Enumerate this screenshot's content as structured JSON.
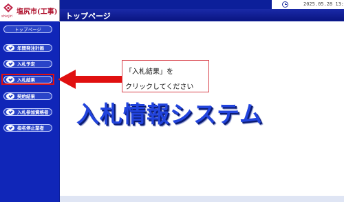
{
  "logo": {
    "name": "塩尻市(工事)",
    "subtext": "shiojiri"
  },
  "header": {
    "datetime": "2025.05.28 13:37",
    "page_title": "トップページ",
    "clock_icon": "clock-icon"
  },
  "sidebar": {
    "top_label": "トップページ",
    "items": [
      {
        "label": "年間発注計画",
        "icon": "check-icon"
      },
      {
        "label": "入札予定",
        "icon": "check-icon"
      },
      {
        "label": "入札結果",
        "icon": "check-icon"
      },
      {
        "label": "契約結果",
        "icon": "check-icon"
      },
      {
        "label": "入札参加資格者",
        "icon": "check-icon"
      },
      {
        "label": "指名停止業者",
        "icon": "check-icon"
      }
    ]
  },
  "main": {
    "system_title": "入札情報システム"
  },
  "callout": {
    "line1": "「入札結果」を",
    "line2": "クリックしてください"
  },
  "colors": {
    "accent": "#1026b8",
    "highlight": "#e01010",
    "title": "#2244dd"
  }
}
